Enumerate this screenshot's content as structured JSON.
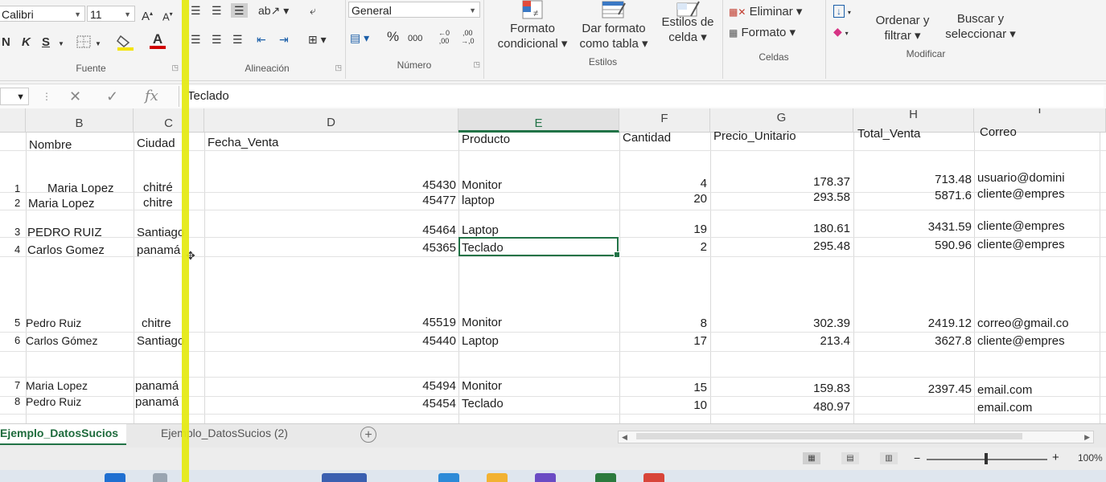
{
  "ribbon": {
    "font_name": "Calibri",
    "font_size": "11",
    "grow_font": "A",
    "shrink_font": "A",
    "bold": "N",
    "italic": "K",
    "underline": "S",
    "font_color_letter": "A",
    "number_format": "General",
    "percent": "%",
    "thousands": "000",
    "groups": {
      "fuente": "Fuente",
      "alineacion": "Alineación",
      "numero": "Número",
      "estilos": "Estilos",
      "celdas": "Celdas",
      "modificar": "Modificar"
    },
    "formato_condicional": [
      "Formato",
      "condicional ▾"
    ],
    "dar_formato_tabla": [
      "Dar formato",
      "como tabla ▾"
    ],
    "estilos_celda": [
      "Estilos de",
      "celda ▾"
    ],
    "eliminar": "Eliminar ▾",
    "formato": "Formato ▾",
    "ordenar_filtrar": [
      "Ordenar y",
      "filtrar ▾"
    ],
    "buscar_seleccionar": [
      "Buscar y",
      "seleccionar ▾"
    ]
  },
  "formula_bar": {
    "fx": "fx",
    "value": "Teclado"
  },
  "columns": [
    "B",
    "C",
    "D",
    "E",
    "F",
    "G",
    "H",
    "I"
  ],
  "headers": {
    "nombre": "Nombre",
    "ciudad": "Ciudad",
    "fecha": "Fecha_Venta",
    "producto": "Producto",
    "cantidad": "Cantidad",
    "precio": "Precio_Unitario",
    "total": "Total_Venta",
    "correo": "Correo"
  },
  "rows": [
    {
      "id": "1",
      "nombre": "Maria Lopez",
      "ciudad": "chitré",
      "fecha": "45430",
      "producto": "Monitor",
      "cantidad": "4",
      "precio": "178.37",
      "total": "713.48",
      "correo": "usuario@domini"
    },
    {
      "id": "2",
      "nombre": "Maria Lopez",
      "ciudad": "chitre",
      "fecha": "45477",
      "producto": "laptop",
      "cantidad": "20",
      "precio": "293.58",
      "total": "5871.6",
      "correo": "cliente@empres"
    },
    {
      "id": "3",
      "nombre": "PEDRO RUIZ",
      "ciudad": "Santiago",
      "fecha": "45464",
      "producto": "Laptop",
      "cantidad": "19",
      "precio": "180.61",
      "total": "3431.59",
      "correo": "cliente@empres"
    },
    {
      "id": "4",
      "nombre": "Carlos Gomez",
      "ciudad": "panamá",
      "fecha": "45365",
      "producto": "Teclado",
      "cantidad": "2",
      "precio": "295.48",
      "total": "590.96",
      "correo": "cliente@empres"
    },
    {
      "id": "5",
      "nombre": "Pedro Ruiz",
      "ciudad": "chitre",
      "fecha": "45519",
      "producto": "Monitor",
      "cantidad": "8",
      "precio": "302.39",
      "total": "2419.12",
      "correo": "correo@gmail.co"
    },
    {
      "id": "6",
      "nombre": "Carlos Gómez",
      "ciudad": "Santiago",
      "fecha": "45440",
      "producto": "Laptop",
      "cantidad": "17",
      "precio": "213.4",
      "total": "3627.8",
      "correo": "cliente@empres"
    },
    {
      "id": "7",
      "nombre": "Maria Lopez",
      "ciudad": "panamá",
      "fecha": "45494",
      "producto": "Monitor",
      "cantidad": "15",
      "precio": "159.83",
      "total": "2397.45",
      "correo": "email.com"
    },
    {
      "id": "8",
      "nombre": "Pedro Ruiz",
      "ciudad": "panamá",
      "fecha": "45454",
      "producto": "Teclado",
      "cantidad": "10",
      "precio": "480.97",
      "total": "",
      "correo": "email.com"
    }
  ],
  "sheets": {
    "active": "Ejemplo_DatosSucios",
    "other": "Ejemplo_DatosSucios (2)",
    "add": "+"
  },
  "status": {
    "zoom": "100%"
  },
  "colors": {
    "accent": "#217346",
    "highlight": "#e5ea16"
  }
}
